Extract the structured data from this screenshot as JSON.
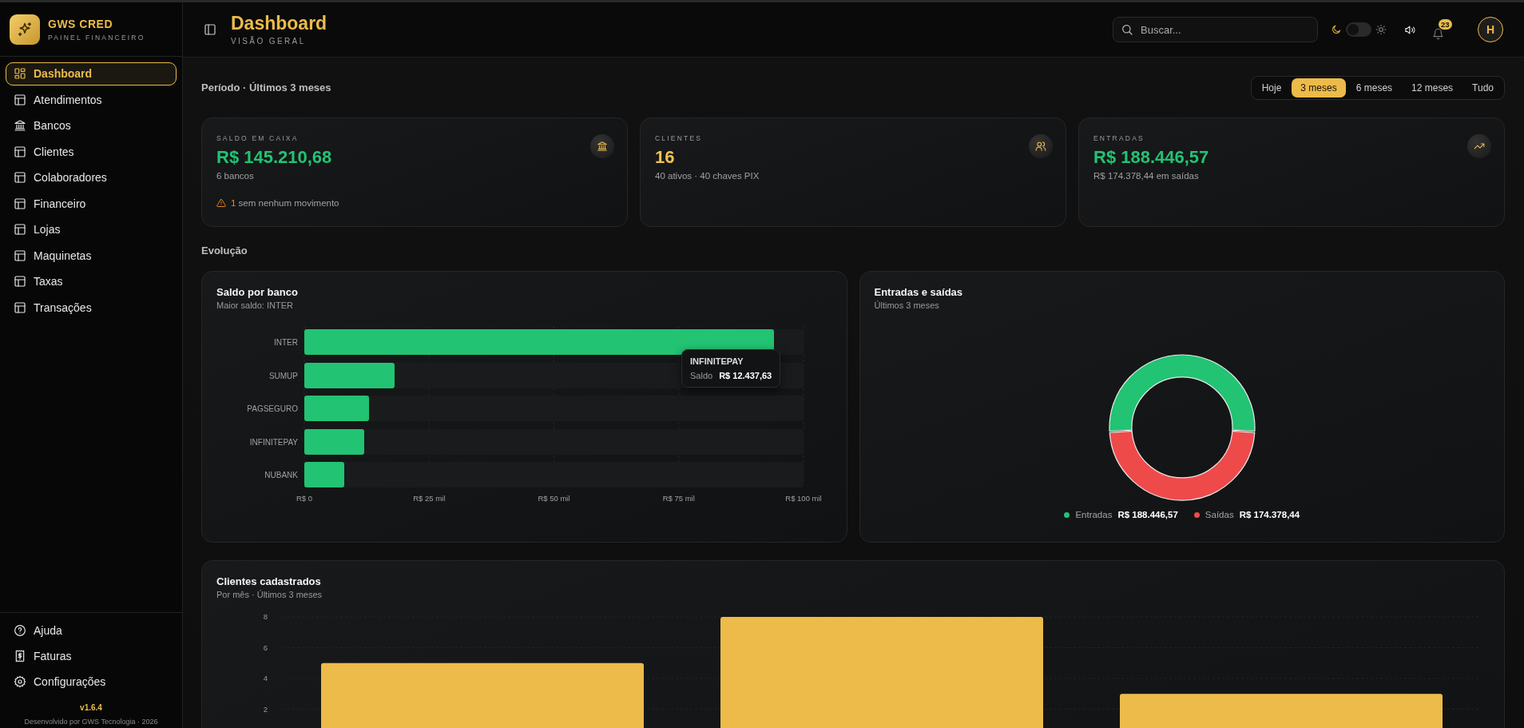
{
  "brand": {
    "name": "GWS CRED",
    "subtitle": "PAINEL FINANCEIRO"
  },
  "sidebar": {
    "items": [
      {
        "label": "Dashboard",
        "kind": "grid",
        "selected": true
      },
      {
        "label": "Atendimentos",
        "kind": "table",
        "selected": false
      },
      {
        "label": "Bancos",
        "kind": "bank",
        "selected": false
      },
      {
        "label": "Clientes",
        "kind": "table",
        "selected": false
      },
      {
        "label": "Colaboradores",
        "kind": "table",
        "selected": false
      },
      {
        "label": "Financeiro",
        "kind": "table",
        "selected": false
      },
      {
        "label": "Lojas",
        "kind": "table",
        "selected": false
      },
      {
        "label": "Maquinetas",
        "kind": "table",
        "selected": false
      },
      {
        "label": "Taxas",
        "kind": "table",
        "selected": false
      },
      {
        "label": "Transações",
        "kind": "table",
        "selected": false
      }
    ],
    "footer_items": [
      {
        "label": "Ajuda",
        "kind": "help"
      },
      {
        "label": "Faturas",
        "kind": "invoice"
      },
      {
        "label": "Configurações",
        "kind": "gear"
      }
    ],
    "version": "v1.6.4",
    "credit": "Desenvolvido por GWS Tecnologia · 2026"
  },
  "header": {
    "title": "Dashboard",
    "subtitle": "VISÃO GERAL",
    "search": {
      "placeholder": "Buscar..."
    },
    "theme_toggle": {
      "on": false
    },
    "notifications": {
      "count": "23"
    },
    "avatar": {
      "initial": "H"
    }
  },
  "period": {
    "label": "Período · Últimos 3 meses",
    "options": [
      {
        "label": "Hoje",
        "selected": false
      },
      {
        "label": "3 meses",
        "selected": true
      },
      {
        "label": "6 meses",
        "selected": false
      },
      {
        "label": "12 meses",
        "selected": false
      },
      {
        "label": "Tudo",
        "selected": false
      }
    ]
  },
  "stats": [
    {
      "kind": "bank",
      "label": "SALDO EM CAIXA",
      "value": "R$ 145.210,68",
      "color": "#22c373",
      "detail": "6 bancos",
      "warning": {
        "count": "1",
        "text": "sem nenhum movimento"
      }
    },
    {
      "kind": "users",
      "label": "CLIENTES",
      "value": "16",
      "color": "#f0c34f",
      "detail": "40 ativos · 40 chaves PIX"
    },
    {
      "kind": "trend",
      "label": "ENTRADAS",
      "value": "R$ 188.446,57",
      "color": "#22c373",
      "detail": "R$ 174.378,44 em saídas"
    }
  ],
  "section_title": "Evolução",
  "bank_chart": {
    "title": "Saldo por banco",
    "subtitle": "Maior saldo: INTER",
    "bars": [
      {
        "label": "INTER",
        "level": 0.94
      },
      {
        "label": "SUMUP",
        "level": 0.18
      },
      {
        "label": "PAGSEGURO",
        "level": 0.13
      },
      {
        "label": "INFINITEPAY",
        "level": 0.12
      },
      {
        "label": "NUBANK",
        "level": 0.08
      }
    ],
    "axis_labels": [
      "R$ 0",
      "R$ 25 mil",
      "R$ 50 mil",
      "R$ 75 mil",
      "R$ 100 mil"
    ],
    "tooltip": {
      "title": "INFINITEPAY",
      "label": "Saldo",
      "value": "R$ 12.437,63"
    }
  },
  "flow_chart": {
    "title": "Entradas e saídas",
    "subtitle": "Últimos 3 meses",
    "chart_data": {
      "type": "donut",
      "categories": [
        "Entradas",
        "Saídas"
      ],
      "series": [
        {
          "values": [
            51.9,
            48.1
          ]
        }
      ]
    },
    "legend": [
      {
        "value": "R$ 188.446,57",
        "color": "#22c373"
      },
      {
        "value": "R$ 174.378,44",
        "color": "#ef4a4a"
      }
    ]
  },
  "clients_chart": {
    "title": "Clientes cadastrados",
    "subtitle": "Por mês · Últimos 3 meses",
    "chart_data": {
      "type": "bar",
      "series": [
        {
          "color": "#ecbb4a",
          "values": [
            5,
            8,
            3
          ]
        }
      ],
      "ylim": [
        0,
        8
      ],
      "grid": true,
      "yticks": [
        2,
        4,
        6,
        8
      ]
    }
  }
}
